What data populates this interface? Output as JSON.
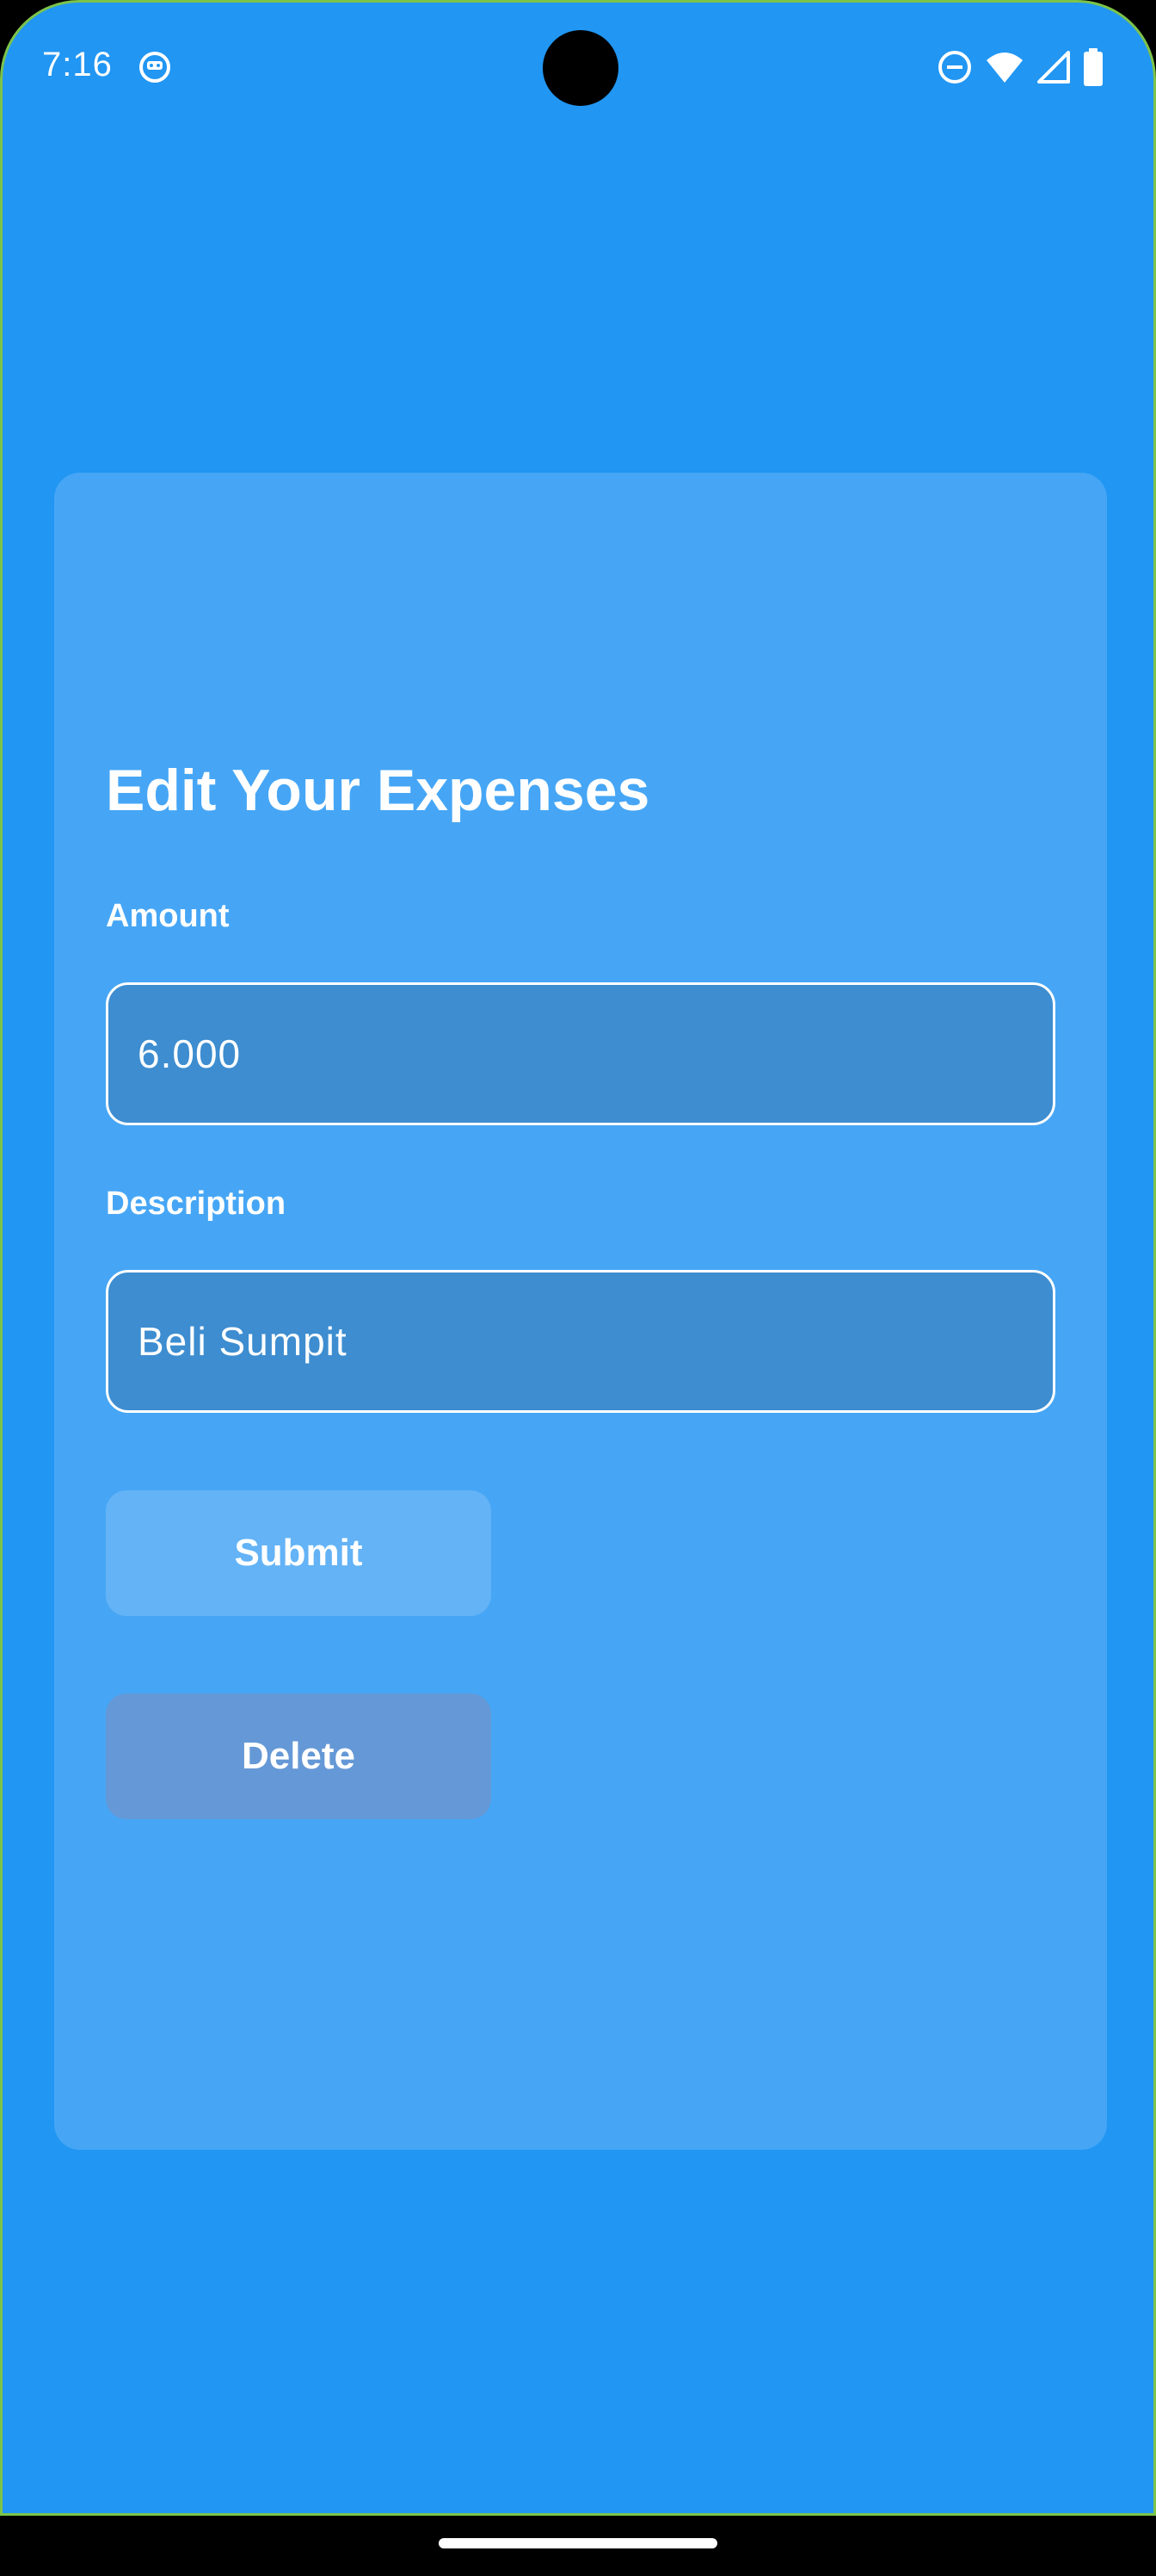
{
  "status_bar": {
    "time": "7:16",
    "icons": [
      "app-notification-icon",
      "do-not-disturb-icon",
      "wifi-icon",
      "cell-signal-icon",
      "battery-icon"
    ]
  },
  "form": {
    "title": "Edit Your Expenses",
    "amount_label": "Amount",
    "amount_value": "6.000",
    "description_label": "Description",
    "description_value": "Beli Sumpit",
    "submit_label": "Submit",
    "delete_label": "Delete"
  },
  "colors": {
    "background": "#2196F3",
    "card": "#46A6F5",
    "field_fill": "#3D8DD0",
    "submit_button": "#63B3F6",
    "delete_button": "#6598D6",
    "text": "#FFFFFF"
  }
}
